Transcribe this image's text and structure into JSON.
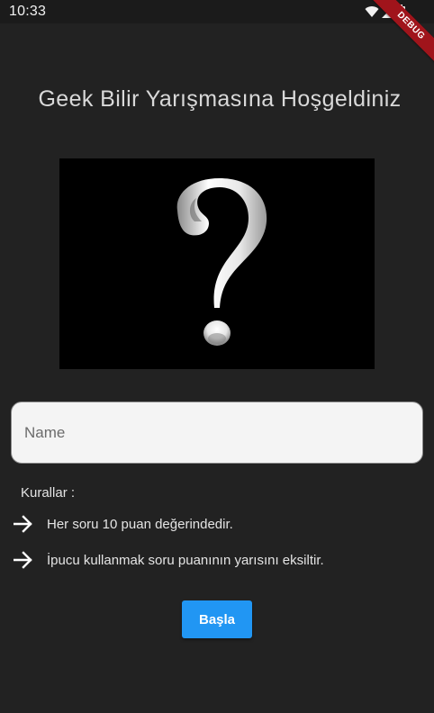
{
  "status_bar": {
    "time": "10:33",
    "icons": [
      "wifi-icon",
      "signal-icon",
      "battery-icon"
    ]
  },
  "debug_banner": {
    "label": "DEBUG",
    "color": "#a0141b"
  },
  "header": {
    "title": "Geek Bilir Yarışmasına Hoşgeldiniz"
  },
  "hero": {
    "icon": "question-mark-icon"
  },
  "form": {
    "name_placeholder": "Name",
    "name_value": ""
  },
  "rules": {
    "heading": "Kurallar :",
    "items": [
      {
        "icon": "arrow-right-icon",
        "text": "Her soru 10 puan değerindedir."
      },
      {
        "icon": "arrow-right-icon",
        "text": "İpucu kullanmak soru puanının yarısını eksiltir."
      }
    ]
  },
  "actions": {
    "start_label": "Başla",
    "accent_color": "#2196f3"
  },
  "colors": {
    "background": "#222222",
    "text": "#e4e4e4"
  }
}
